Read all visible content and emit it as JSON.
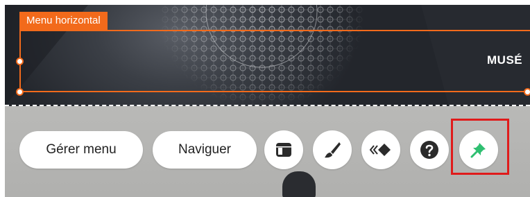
{
  "selection": {
    "label": "Menu horizontal",
    "accent_color": "#f26a1b"
  },
  "menu": {
    "first_item": "MUSÉ"
  },
  "toolbar": {
    "manage_menu_label": "Gérer menu",
    "navigate_label": "Naviguer",
    "icons": [
      "layout-icon",
      "brush-icon",
      "animation-icon",
      "help-icon",
      "pin-icon"
    ],
    "pin_color": "#2fbf71"
  },
  "annotation": {
    "highlight_color": "#e01b1b"
  }
}
